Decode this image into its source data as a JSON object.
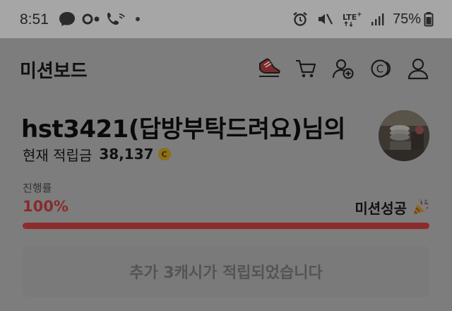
{
  "status_bar": {
    "time": "8:51",
    "battery_percent": "75%",
    "network": "LTE+",
    "icons": [
      "messenger-icon",
      "notification-icon",
      "wifi-calling-icon",
      "alarm-icon",
      "mute-icon",
      "signal-icon",
      "battery-icon"
    ]
  },
  "header": {
    "title": "미션보드",
    "icons": [
      "mission-shoe-icon",
      "cart-icon",
      "add-friend-icon",
      "cash-coin-icon",
      "profile-icon"
    ]
  },
  "profile": {
    "greeting": "hst3421(답방부탁드려요)님의",
    "points_label": "현재 적립금",
    "points_value": "38,137",
    "coin_symbol": "C"
  },
  "progress": {
    "caption": "진행률",
    "percent_text": "100%",
    "fill_fraction": 1.0,
    "status_text": "미션성공"
  },
  "notice": {
    "text": "추가 3캐시가 적립되었습니다"
  },
  "colors": {
    "overlay_gray": "#7d7d7d",
    "progress_red": "#8d2c2c",
    "coin_gold": "#8d6f1a"
  }
}
